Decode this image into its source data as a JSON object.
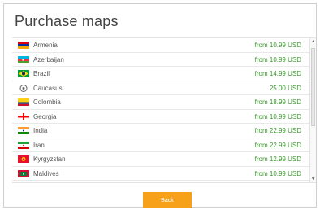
{
  "dialog": {
    "title": "Purchase maps"
  },
  "countries": [
    {
      "name": "Armenia",
      "price": "from 10.99 USD",
      "flag": "armenia-flag-icon"
    },
    {
      "name": "Azerbaijan",
      "price": "from 10.99 USD",
      "flag": "azerbaijan-flag-icon"
    },
    {
      "name": "Brazil",
      "price": "from 14.99 USD",
      "flag": "brazil-flag-icon"
    },
    {
      "name": "Caucasus",
      "price": "25.00 USD",
      "flag": "caucasus-region-icon"
    },
    {
      "name": "Colombia",
      "price": "from 18.99 USD",
      "flag": "colombia-flag-icon"
    },
    {
      "name": "Georgia",
      "price": "from 10.99 USD",
      "flag": "georgia-flag-icon"
    },
    {
      "name": "India",
      "price": "from 22.99 USD",
      "flag": "india-flag-icon"
    },
    {
      "name": "Iran",
      "price": "from 22.99 USD",
      "flag": "iran-flag-icon"
    },
    {
      "name": "Kyrgyzstan",
      "price": "from 12.99 USD",
      "flag": "kyrgyzstan-flag-icon"
    },
    {
      "name": "Maldives",
      "price": "from 10.99 USD",
      "flag": "maldives-flag-icon"
    }
  ],
  "footer": {
    "back_label": "Back"
  },
  "colors": {
    "price": "#3a9a2c",
    "button": "#f7a11a",
    "title": "#444444"
  }
}
